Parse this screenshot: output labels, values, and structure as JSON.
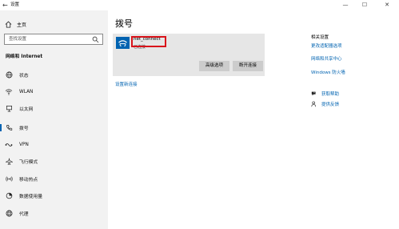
{
  "window": {
    "back_glyph": "←",
    "title": "设置",
    "controls": {
      "minimize": "—",
      "maximize": "☐",
      "close": "✕"
    }
  },
  "sidebar": {
    "home_label": "主页",
    "search_placeholder": "查找设置",
    "section_title": "网络和 Internet",
    "items": [
      {
        "label": "状态",
        "icon": "globe-icon"
      },
      {
        "label": "WLAN",
        "icon": "wifi-icon"
      },
      {
        "label": "以太网",
        "icon": "ethernet-icon"
      },
      {
        "label": "拨号",
        "icon": "phone-icon",
        "active": true
      },
      {
        "label": "VPN",
        "icon": "vpn-icon"
      },
      {
        "label": "飞行模式",
        "icon": "airplane-icon"
      },
      {
        "label": "移动热点",
        "icon": "hotspot-icon"
      },
      {
        "label": "数据使用量",
        "icon": "data-usage-icon"
      },
      {
        "label": "代理",
        "icon": "proxy-icon"
      }
    ]
  },
  "main": {
    "title": "拨号",
    "connection": {
      "name": "net_connect",
      "status": "已连接",
      "advanced_button": "高级选项",
      "disconnect_button": "断开连接"
    },
    "setup_link": "设置新连接"
  },
  "related": {
    "title": "相关设置",
    "links": [
      "更改适配器选项",
      "网络和共享中心",
      "Windows 防火墙"
    ],
    "help": [
      {
        "label": "获取帮助",
        "icon": "help-icon"
      },
      {
        "label": "提供反馈",
        "icon": "feedback-icon"
      }
    ]
  },
  "colors": {
    "accent": "#0063b1",
    "highlight_box": "#d9141b",
    "sidebar_bg": "#f2f2f2",
    "card_bg": "#e6e6e6",
    "button_bg": "#cccccc"
  }
}
